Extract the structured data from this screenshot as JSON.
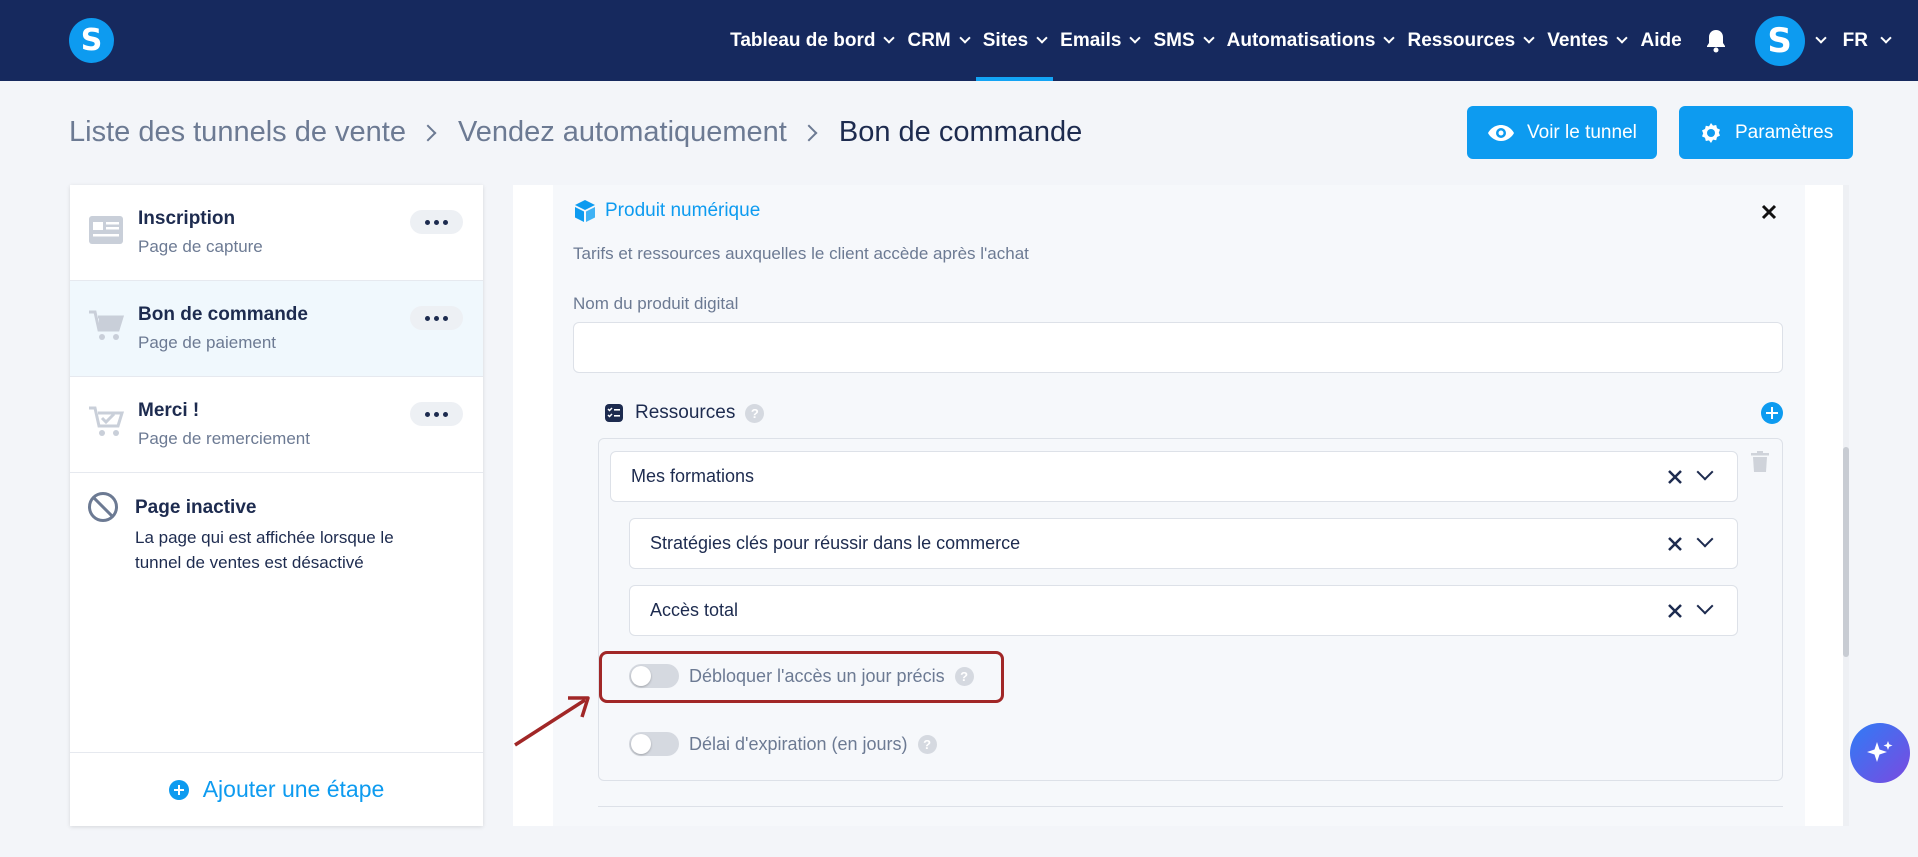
{
  "app": {
    "logo_letter": "S",
    "brand_color": "#0d9bf0",
    "nav_bg": "#16295e"
  },
  "nav": {
    "items": [
      {
        "label": "Tableau de bord",
        "has_menu": true
      },
      {
        "label": "CRM",
        "has_menu": true
      },
      {
        "label": "Sites",
        "has_menu": true,
        "active": true
      },
      {
        "label": "Emails",
        "has_menu": true
      },
      {
        "label": "SMS",
        "has_menu": true
      },
      {
        "label": "Automatisations",
        "has_menu": true
      },
      {
        "label": "Ressources",
        "has_menu": true
      },
      {
        "label": "Ventes",
        "has_menu": true
      },
      {
        "label": "Aide",
        "has_menu": false
      }
    ],
    "avatar_letter": "S",
    "language": "FR"
  },
  "breadcrumb": [
    "Liste des tunnels de vente",
    "Vendez automatiquement",
    "Bon de commande"
  ],
  "actions": {
    "view_label": "Voir le tunnel",
    "settings_label": "Paramètres"
  },
  "steps": [
    {
      "title": "Inscription",
      "subtitle": "Page de capture",
      "icon": "form-icon"
    },
    {
      "title": "Bon de commande",
      "subtitle": "Page de paiement",
      "icon": "cart-icon",
      "selected": true
    },
    {
      "title": "Merci !",
      "subtitle": "Page de remerciement",
      "icon": "cart-check-icon"
    }
  ],
  "inactive": {
    "title": "Page inactive",
    "description": "La page qui est affichée lorsque le tunnel de ventes est désactivé"
  },
  "add_step_label": "Ajouter une étape",
  "product": {
    "title": "Produit numérique",
    "description": "Tarifs et ressources auxquelles le client accède après l'achat",
    "name_label": "Nom du produit digital",
    "name_value": "",
    "resources_label": "Ressources",
    "help_mark": "?",
    "resources": {
      "type": "Mes formations",
      "course": "Stratégies clés pour réussir dans le commerce",
      "access": "Accès total"
    },
    "unlock_label": "Débloquer l'accès un jour précis",
    "unlock_on": false,
    "expiry_label": "Délai d'expiration (en jours)",
    "expiry_on": false
  }
}
